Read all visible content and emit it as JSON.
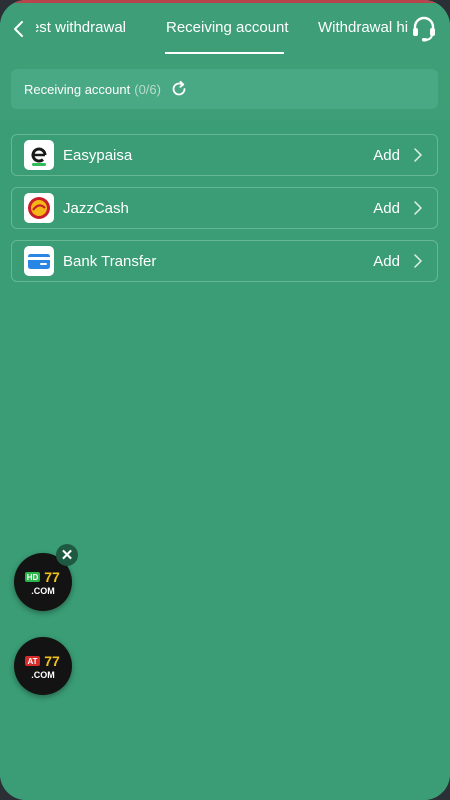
{
  "header": {
    "tabs": [
      {
        "label": "Request withdrawal"
      },
      {
        "label": "Receiving account",
        "active": true
      },
      {
        "label": "Withdrawal history"
      }
    ],
    "back_icon": "chevron-left-icon",
    "support_icon": "headset-icon"
  },
  "account_summary": {
    "label": "Receiving account",
    "count": "(0/6)",
    "refresh_icon": "refresh-icon"
  },
  "methods": [
    {
      "name": "Easypaisa",
      "action": "Add",
      "icon": "easypaisa-logo"
    },
    {
      "name": "JazzCash",
      "action": "Add",
      "icon": "jazzcash-logo"
    },
    {
      "name": "Bank Transfer",
      "action": "Add",
      "icon": "bank-card-icon"
    }
  ],
  "floating_ads": [
    {
      "brand": "HD77",
      "domain": ".COM"
    },
    {
      "brand": "AT77",
      "domain": ".COM"
    }
  ],
  "colors": {
    "background": "#3d9e77",
    "accent_top": "#b8454d",
    "row_border": "#66b894"
  }
}
